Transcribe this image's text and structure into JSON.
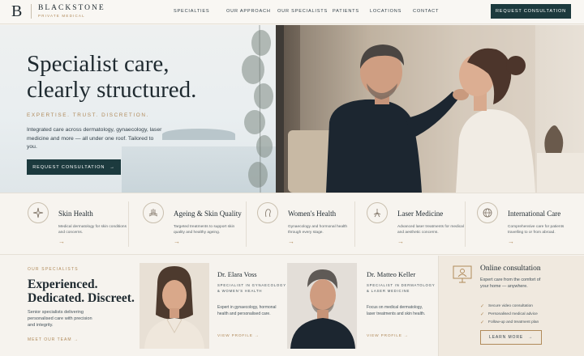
{
  "brand": {
    "mark": "B",
    "name": "BLACKSTONE",
    "sub": "PRIVATE MEDICAL"
  },
  "nav": {
    "items": [
      "SPECIALTIES",
      "OUR APPROACH",
      "OUR SPECIALISTS",
      "PATIENTS",
      "LOCATIONS",
      "CONTACT"
    ],
    "cta": "REQUEST CONSULTATION"
  },
  "hero": {
    "title": "Specialist care,\nclearly structured.",
    "tagline": "EXPERTISE. TRUST. DISCRETION.",
    "text": "Integrated care across dermatology, gynaecology, laser medicine and more — all under one roof. Tailored to you.",
    "cta": "REQUEST CONSULTATION",
    "cta_arrow": "→"
  },
  "services": [
    {
      "title": "Skin Health",
      "desc": "Medical dermatology for skin conditions and concerns.",
      "icon": "sparkle-icon"
    },
    {
      "title": "Ageing & Skin Quality",
      "desc": "Targeted treatments to support skin quality and healthy ageing.",
      "icon": "skin-layers-icon"
    },
    {
      "title": "Women's Health",
      "desc": "Gynaecology and hormonal health through every stage.",
      "icon": "woman-profile-icon"
    },
    {
      "title": "Laser Medicine",
      "desc": "Advanced laser treatments for medical and aesthetic concerns.",
      "icon": "laser-icon"
    },
    {
      "title": "International Care",
      "desc": "Comprehensive care for patients travelling to or from abroad.",
      "icon": "globe-icon"
    }
  ],
  "services_arrow": "→",
  "specialists": {
    "eyebrow": "OUR SPECIALISTS",
    "heading": "Experienced.\nDedicated. Discreet.",
    "text": "Senior specialists delivering personalised care with precision and integrity.",
    "link": "MEET OUR TEAM →",
    "doctors": [
      {
        "name": "Dr. Elara Voss",
        "role": "SPECIALIST IN GYNAECOLOGY & WOMEN'S HEALTH",
        "text": "Expert in gynaecology, hormonal health and personalised care.",
        "link": "VIEW PROFILE →"
      },
      {
        "name": "Dr. Matteo Keller",
        "role": "SPECIALIST IN DERMATOLOGY & LASER MEDICINE",
        "text": "Focus on medical dermatology, laser treatments and skin health.",
        "link": "VIEW PROFILE →"
      }
    ]
  },
  "online": {
    "title": "Online consultation",
    "desc": "Expert care from the comfort of your home — anywhere.",
    "checks": [
      "Secure video consultation",
      "Personalised medical advice",
      "Follow-up and treatment plan"
    ],
    "check_mark": "✓",
    "button": "LEARN MORE",
    "button_arrow": "→"
  },
  "colors": {
    "navy": "#1c3a3e",
    "gold": "#b08a5a",
    "background": "#f6f3ee"
  }
}
